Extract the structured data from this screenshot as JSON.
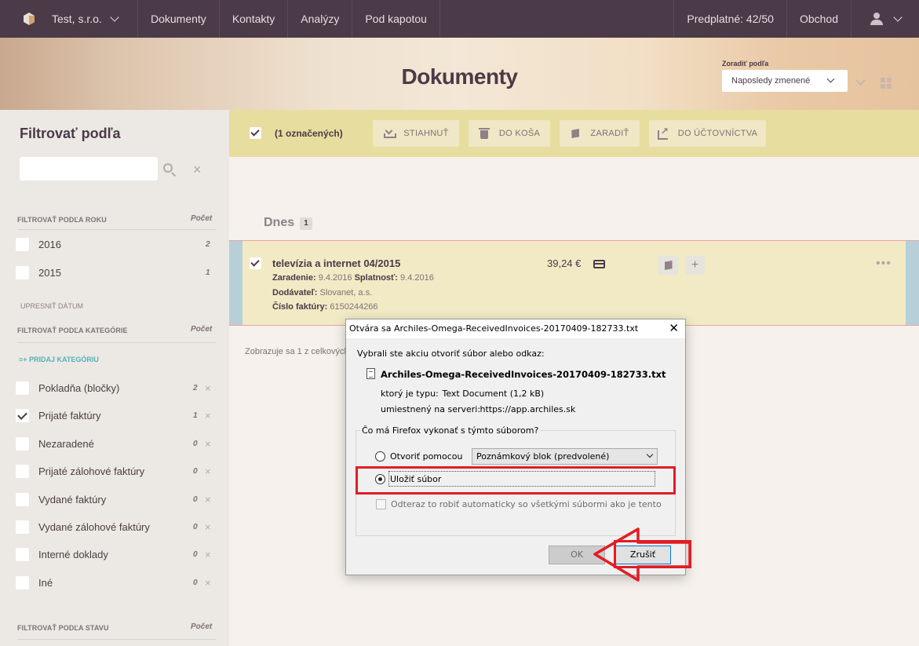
{
  "topnav": {
    "company": "Test, s.r.o.",
    "items": [
      "Dokumenty",
      "Kontakty",
      "Analýzy",
      "Pod kapotou"
    ],
    "subscription": "Predplatné: 42/50",
    "shop": "Obchod"
  },
  "banner": {
    "title": "Dokumenty",
    "sort_label": "Zoradiť podľa",
    "sort_value": "Naposledy zmenené"
  },
  "sidebar": {
    "title": "Filtrovať podľa",
    "search_placeholder": "",
    "year_section": "FILTROVAŤ PODĽA ROKU",
    "count_header": "Počet",
    "years": [
      {
        "label": "2016",
        "count": "2"
      },
      {
        "label": "2015",
        "count": "1"
      }
    ],
    "refine_date": "UPRESNIŤ DÁTUM",
    "category_section": "FILTROVAŤ PODĽA KATEGÓRIE",
    "add_category": "≡+ PRIDAJ KATEGÓRIU",
    "categories": [
      {
        "label": "Pokladňa (bločky)",
        "count": "2",
        "checked": false
      },
      {
        "label": "Prijaté faktúry",
        "count": "1",
        "checked": true
      },
      {
        "label": "Nezaradené",
        "count": "0",
        "checked": false
      },
      {
        "label": "Prijaté zálohové faktúry",
        "count": "0",
        "checked": false
      },
      {
        "label": "Vydané faktúry",
        "count": "0",
        "checked": false
      },
      {
        "label": "Vydané zálohové faktúry",
        "count": "0",
        "checked": false
      },
      {
        "label": "Interné doklady",
        "count": "0",
        "checked": false
      },
      {
        "label": "Iné",
        "count": "0",
        "checked": false
      }
    ],
    "status_section": "FILTROVAŤ PODĽA STAVU"
  },
  "toolbar": {
    "selected": "(1 označených)",
    "download": "STIAHNUŤ",
    "trash": "DO KOŠA",
    "classify": "ZARADIŤ",
    "accounting": "DO ÚČTOVNÍCTVA"
  },
  "list": {
    "day": "Dnes",
    "day_count": "1",
    "document": {
      "title": "televízia a internet 04/2015",
      "classified_label": "Zaradenie:",
      "classified_value": "9.4.2016",
      "due_label": "Splatnosť:",
      "due_value": "9.4.2016",
      "supplier_label": "Dodávateľ:",
      "supplier_value": "Slovanet, a.s.",
      "invoice_label": "Číslo faktúry:",
      "invoice_value": "6150244266",
      "amount": "39,24 €",
      "plus": "+",
      "more": "•••"
    },
    "showing": "Zobrazuje sa 1 z celkových"
  },
  "dialog": {
    "title": "Otvára sa Archiles-Omega-ReceivedInvoices-20170409-182733.txt",
    "close": "✕",
    "intro": "Vybrali ste akciu otvoriť súbor alebo odkaz:",
    "filename": "Archiles-Omega-ReceivedInvoices-20170409-182733.txt",
    "type_label": "ktorý je typu:",
    "type_value": "Text Document (1,2 kB)",
    "server_label": "umiestnený na serveri:",
    "server_value": "https://app.archiles.sk",
    "question": "Čo má Firefox vykonať s týmto súborom?",
    "open_with": "Otvoriť pomocou",
    "app": "Poznámkový blok (predvolené)",
    "save_file": "Uložiť súbor",
    "auto": "Odteraz to robiť automaticky so všetkými súbormi ako je tento",
    "ok": "OK",
    "cancel": "Zrušiť"
  },
  "colors": {
    "nav": "#4b3a47",
    "toolbar": "#e7dd9e",
    "selected_row": "#f1eac5",
    "annotation": "#e31c23"
  }
}
